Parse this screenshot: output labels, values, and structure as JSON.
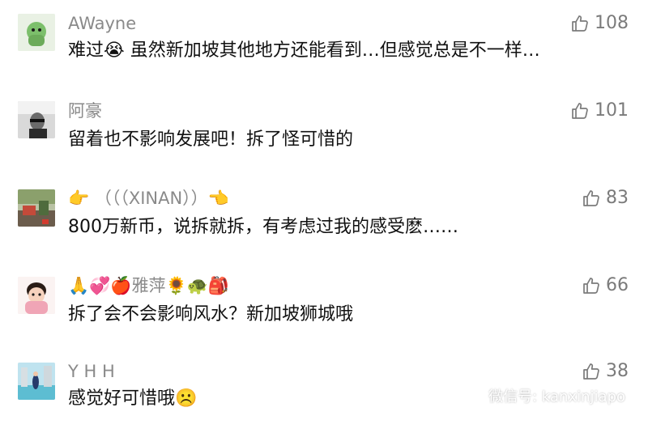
{
  "comments": [
    {
      "user": "AWayne",
      "text": "难过😭 虽然新加坡其他地方还能看到…但感觉总是不一样…",
      "likes": "108"
    },
    {
      "user": "阿豪",
      "text": "留着也不影响发展吧！拆了怪可惜的",
      "likes": "101"
    },
    {
      "user": "👉 （（（XINAN））👈",
      "text": "800万新币，说拆就拆，有考虑过我的感受麽……",
      "likes": "83"
    },
    {
      "user": "🙏💞🍎雅萍🌻🐢🎒",
      "text": "拆了会不会影响风水？新加坡狮城哦",
      "likes": "66"
    },
    {
      "user": "Y H H",
      "text": "感觉好可惜哦☹️",
      "likes": "38"
    }
  ],
  "watermark": {
    "label": "微信号: kanxinjiapo"
  },
  "icons": {
    "like": "thumbs-up-icon",
    "wechat": "wechat-icon"
  },
  "colors": {
    "name": "#8a8a8a",
    "text": "#111111",
    "like": "#7b7b7b"
  }
}
